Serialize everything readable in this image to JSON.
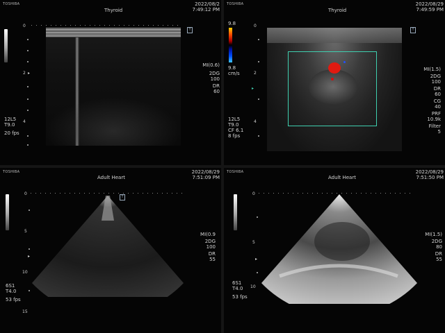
{
  "panels": [
    {
      "brand": "TOSHIBA",
      "title": "Thyroid",
      "date": "2022/08/2",
      "time": "7:49:12 PM",
      "scale_top": "0",
      "scale_mid": "2",
      "scale_bot": "4",
      "probe": "12L5",
      "tis": "T9.0",
      "fps": "20 fps",
      "right_params": [
        "MI(0.6)",
        "2DG",
        "100",
        "DR",
        "60"
      ]
    },
    {
      "brand": "TOSHIBA",
      "title": "Thyroid",
      "date": "2022/08/29",
      "time": "7:49:59 PM",
      "scale_top": "0",
      "scale_mid": "2",
      "scale_bot": "4",
      "color_top": "9.8",
      "color_bot": "9.8",
      "color_unit": "cm/s",
      "probe": "12L5",
      "tis": "T9.0",
      "cf": "CF 6.1",
      "fps": "8 fps",
      "right_params": [
        "MI(1.5)",
        "2DG",
        "100",
        "DR",
        "60",
        "CG",
        "40",
        "PRF",
        "10.9k",
        "Filter",
        "5"
      ]
    },
    {
      "brand": "TOSHIBA",
      "title": "Adult Heart",
      "date": "2022/08/29",
      "time": "7:51:09 PM",
      "scale_top": "0",
      "scale_mid": "5",
      "scale_10": "10",
      "scale_bot": "15",
      "probe": "6S1",
      "tis": "T4.0",
      "fps": "53 fps",
      "right_params": [
        "MI(0.9",
        "2DG",
        "100",
        "DR",
        "55"
      ]
    },
    {
      "brand": "TOSHIBA",
      "title": "Adult Heart",
      "date": "2022/08/29",
      "time": "7:51:50 PM",
      "scale_top": "0",
      "scale_mid": "5",
      "scale_10": "10",
      "probe": "6S1",
      "tis": "T4.0",
      "fps": "53 fps",
      "right_params": [
        "MI(1.5)",
        "2DG",
        "80",
        "DR",
        "55"
      ]
    }
  ],
  "colors": {
    "background": "#000000",
    "text": "#d6d6d6",
    "doppler_red": "#e11a10",
    "doppler_blue": "#2050ff",
    "roi_box": "#3fd0b0"
  }
}
